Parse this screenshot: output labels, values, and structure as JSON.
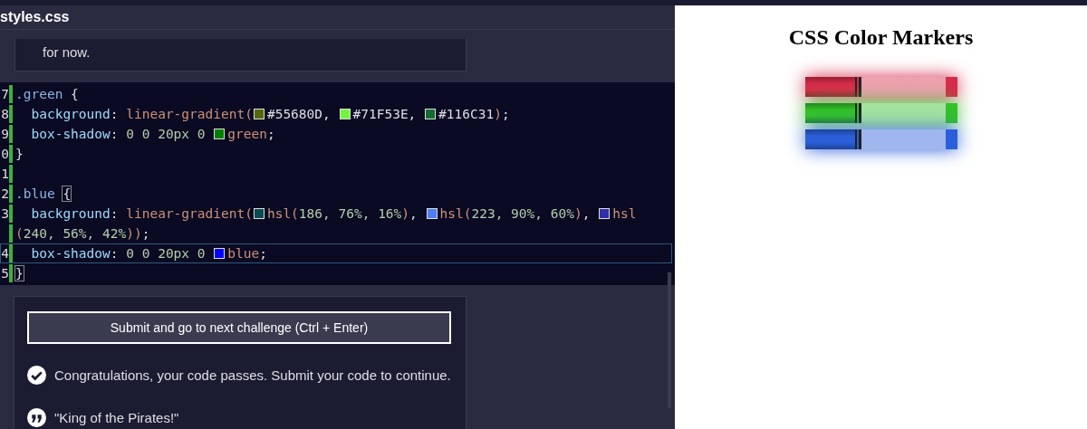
{
  "editor": {
    "file_tab": "styles.css",
    "instructions_tail": "for now.",
    "lines": [
      {
        "number": "7",
        "active": false,
        "tokens": [
          {
            "kind": "selector",
            "t": ".green"
          },
          {
            "kind": "punct",
            "t": " {"
          }
        ]
      },
      {
        "number": "8",
        "active": false,
        "tokens": [
          {
            "kind": "prop",
            "t": "  background"
          },
          {
            "kind": "punct",
            "t": ": "
          },
          {
            "kind": "func",
            "t": "linear-gradient("
          },
          {
            "kind": "swatch",
            "color": "#55680d"
          },
          {
            "kind": "value",
            "t": "#55680D"
          },
          {
            "kind": "punct",
            "t": ", "
          },
          {
            "kind": "swatch",
            "color": "#71f53e"
          },
          {
            "kind": "value",
            "t": "#71F53E"
          },
          {
            "kind": "punct",
            "t": ", "
          },
          {
            "kind": "swatch",
            "color": "#116c31"
          },
          {
            "kind": "value",
            "t": "#116C31"
          },
          {
            "kind": "func",
            "t": ")"
          },
          {
            "kind": "punct",
            "t": ";"
          }
        ]
      },
      {
        "number": "9",
        "active": false,
        "tokens": [
          {
            "kind": "prop",
            "t": "  box-shadow"
          },
          {
            "kind": "punct",
            "t": ": "
          },
          {
            "kind": "num",
            "t": "0 0 20px 0 "
          },
          {
            "kind": "swatch",
            "color": "#008000"
          },
          {
            "kind": "func",
            "t": "green"
          },
          {
            "kind": "punct",
            "t": ";"
          }
        ]
      },
      {
        "number": "0",
        "active": false,
        "tokens": [
          {
            "kind": "punct",
            "t": "}"
          }
        ]
      },
      {
        "number": "1",
        "active": false
      },
      {
        "number": "2",
        "active": false,
        "tokens": [
          {
            "kind": "selector",
            "t": ".blue "
          },
          {
            "kind": "brace",
            "t": "{"
          }
        ]
      },
      {
        "number": "3",
        "active": false,
        "tokens": [
          {
            "kind": "prop",
            "t": "  background"
          },
          {
            "kind": "punct",
            "t": ": "
          },
          {
            "kind": "func",
            "t": "linear-gradient("
          },
          {
            "kind": "swatch",
            "color": "#0a4a51"
          },
          {
            "kind": "func",
            "t": "hsl("
          },
          {
            "kind": "num",
            "t": "186, 76%, 16%"
          },
          {
            "kind": "func",
            "t": ")"
          },
          {
            "kind": "punct",
            "t": ", "
          },
          {
            "kind": "swatch",
            "color": "#4d7ff3"
          },
          {
            "kind": "func",
            "t": "hsl("
          },
          {
            "kind": "num",
            "t": "223, 90%, 60%"
          },
          {
            "kind": "func",
            "t": ")"
          },
          {
            "kind": "punct",
            "t": ", "
          },
          {
            "kind": "swatch",
            "color": "#2f2fa7"
          },
          {
            "kind": "func",
            "t": "hsl"
          }
        ]
      },
      {
        "active": false,
        "tokens": [
          {
            "kind": "func",
            "t": "("
          },
          {
            "kind": "num",
            "t": "240, 56%, 42%"
          },
          {
            "kind": "func",
            "t": "))"
          },
          {
            "kind": "punct",
            "t": ";"
          }
        ]
      },
      {
        "number": "4",
        "active": true,
        "tokens": [
          {
            "kind": "prop",
            "t": "  box-shadow"
          },
          {
            "kind": "punct",
            "t": ": "
          },
          {
            "kind": "num",
            "t": "0 0 20px 0 "
          },
          {
            "kind": "swatch",
            "color": "#0000ff"
          },
          {
            "kind": "func",
            "t": "blue"
          },
          {
            "kind": "punct",
            "t": ";"
          }
        ]
      },
      {
        "number": "5",
        "active": false,
        "tokens": [
          {
            "kind": "brace",
            "t": "}"
          }
        ]
      }
    ]
  },
  "submit_button": "Submit and go to next challenge (Ctrl + Enter)",
  "messages": [
    {
      "kind": "check",
      "text": "Congratulations, your code passes. Submit your code to continue."
    },
    {
      "kind": "quote",
      "text": "\"King of the Pirates!\""
    }
  ],
  "preview": {
    "title": "CSS Color Markers",
    "markers": [
      {
        "color": "#d62c4a"
      },
      {
        "color": "#33c22a"
      },
      {
        "color": "#2b5fd9"
      }
    ]
  }
}
